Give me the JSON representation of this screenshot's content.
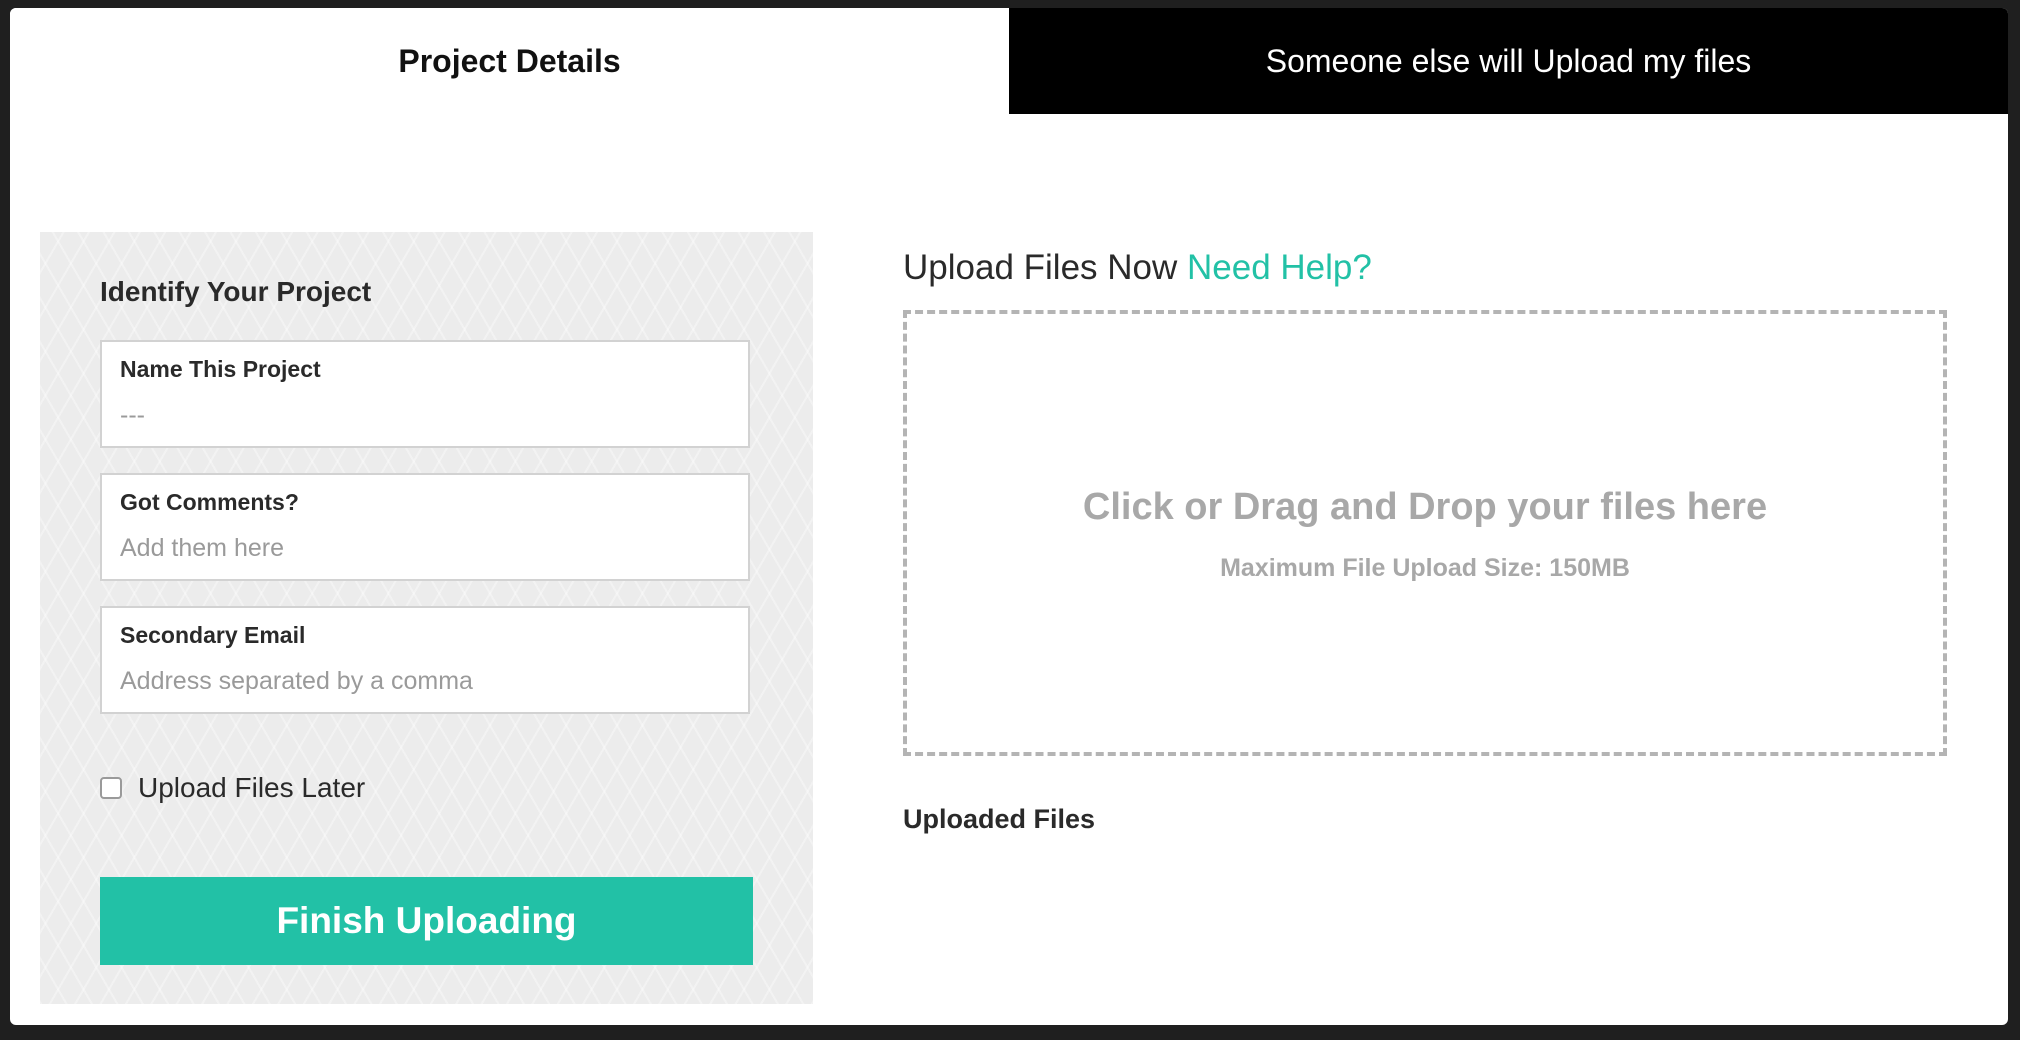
{
  "tabs": [
    {
      "label": "Project Details",
      "active": true
    },
    {
      "label": "Someone else will Upload my files",
      "active": false
    }
  ],
  "form": {
    "title": "Identify Your Project",
    "fields": [
      {
        "label": "Name This Project",
        "placeholder": "---",
        "value": ""
      },
      {
        "label": "Got Comments?",
        "placeholder": "Add them here",
        "value": ""
      },
      {
        "label": "Secondary Email",
        "placeholder": "Address separated by a comma",
        "value": ""
      }
    ],
    "upload_later_label": "Upload Files Later",
    "upload_later_checked": false,
    "finish_label": "Finish Uploading"
  },
  "upload": {
    "heading": "Upload Files Now",
    "help_link": "Need Help?",
    "dropzone_text": "Click or Drag and Drop your files here",
    "max_size_text": "Maximum File Upload Size: 150MB",
    "uploaded_title": "Uploaded Files"
  },
  "colors": {
    "accent": "#22c1a6",
    "inactive_tab_bg": "#000000",
    "panel_bg": "#ececec"
  }
}
